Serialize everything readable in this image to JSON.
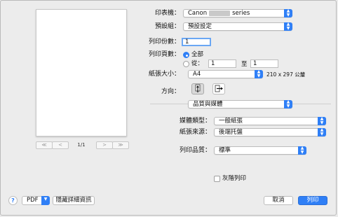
{
  "printer": {
    "label": "印表機：",
    "value_prefix": "Canon",
    "value_suffix": "series"
  },
  "presets": {
    "label": "預設組：",
    "value": "預設設定"
  },
  "copies": {
    "label": "列印份數：",
    "value": "1"
  },
  "pages": {
    "label": "列印頁數：",
    "all": "全部",
    "from": "從：",
    "from_value": "1",
    "to": "至",
    "to_value": "1"
  },
  "paper_size": {
    "label": "紙張大小：",
    "value": "A4",
    "dims": "210 x 297 公釐"
  },
  "orientation": {
    "label": "方向："
  },
  "section": {
    "value": "品質與媒體"
  },
  "media_type": {
    "label": "媒體類型：",
    "value": "一般紙張"
  },
  "paper_source": {
    "label": "紙張來源：",
    "value": "後端托盤"
  },
  "print_quality": {
    "label": "列印品質：",
    "value": "標準"
  },
  "grayscale": {
    "label": "灰階列印"
  },
  "pager": {
    "prev_first": "≪",
    "prev": "<",
    "text": "1/1",
    "next": ">",
    "next_last": "≫"
  },
  "bottom": {
    "help": "?",
    "pdf": "PDF",
    "hide_details": "隱藏詳細資訊",
    "cancel": "取消",
    "print": "列印"
  },
  "colors": {
    "accent": "#2f7ff6"
  }
}
